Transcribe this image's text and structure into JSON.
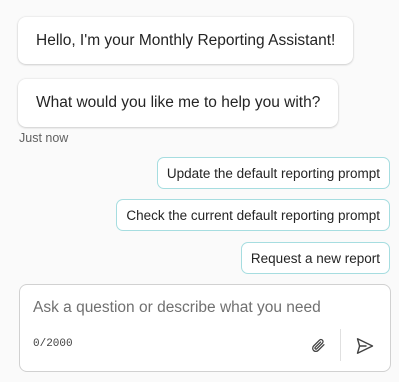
{
  "messages": [
    {
      "text": "Hello, I'm your Monthly Reporting Assistant!"
    },
    {
      "text": "What would you like me to help you with?"
    }
  ],
  "timestamp": "Just now",
  "suggestions": [
    {
      "label": "Update the default reporting prompt"
    },
    {
      "label": "Check the current default reporting prompt"
    },
    {
      "label": "Request a new report"
    }
  ],
  "composer": {
    "placeholder": "Ask a question or describe what you need",
    "value": "",
    "char_count": "0/2000",
    "attach_icon": "paperclip-icon",
    "send_icon": "send-icon"
  },
  "colors": {
    "suggestion_border": "#a6dde0",
    "background": "#fafafa"
  }
}
